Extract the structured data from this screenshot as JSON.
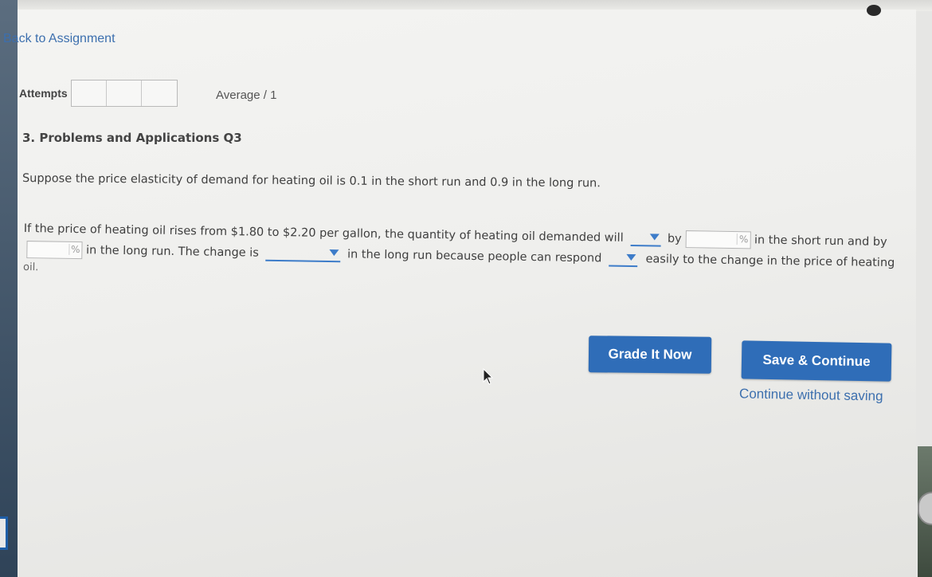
{
  "nav": {
    "back_label": "Back to Assignment"
  },
  "attempts": {
    "label": "Attempts",
    "average_label": "Average / 1"
  },
  "question": {
    "title": "3. Problems and Applications Q3",
    "intro": "Suppose the price elasticity of demand for heating oil is 0.1 in the short run and 0.9 in the long run.",
    "part1": "If the price of heating oil rises from $1.80 to $2.20 per gallon, the quantity of heating oil demanded will",
    "by_label": "by",
    "pct_symbol": "%",
    "short_run_label": "in the short run and by",
    "long_run_label": "in the long run. The change is",
    "because_label": "in the long run because people can respond",
    "easily_label": "easily to the change in the price of heating",
    "tail": "oil."
  },
  "actions": {
    "grade_label": "Grade It Now",
    "save_label": "Save & Continue",
    "continue_label": "Continue without saving"
  },
  "colors": {
    "accent": "#2f6db8",
    "link": "#3c6fae"
  }
}
